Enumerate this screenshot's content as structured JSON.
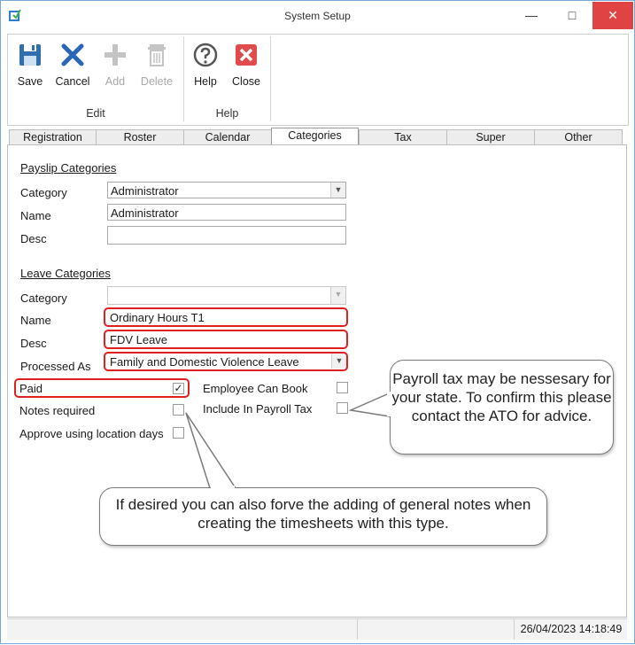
{
  "window": {
    "title": "System Setup",
    "minimize": "—",
    "maximize": "□",
    "close": "✕"
  },
  "ribbon": {
    "buttons": [
      {
        "label": "Save",
        "icon": "save-icon"
      },
      {
        "label": "Cancel",
        "icon": "x-icon"
      },
      {
        "label": "Add",
        "icon": "plus-icon",
        "disabled": true
      },
      {
        "label": "Delete",
        "icon": "trash-icon",
        "disabled": true
      },
      {
        "label": "Help",
        "icon": "question-icon"
      },
      {
        "label": "Close",
        "icon": "close-box-icon"
      }
    ],
    "groups": {
      "edit": "Edit",
      "help": "Help"
    }
  },
  "tabs": [
    "Registration",
    "Roster",
    "Calendar",
    "Categories",
    "Tax",
    "Super",
    "Other"
  ],
  "active_tab": "Categories",
  "payslip": {
    "heading": "Payslip Categories",
    "category_label": "Category",
    "category_value": "Administrator",
    "name_label": "Name",
    "name_value": "Administrator",
    "desc_label": "Desc",
    "desc_value": ""
  },
  "leave": {
    "heading": "Leave Categories",
    "category_label": "Category",
    "category_value": "",
    "name_label": "Name",
    "name_value": "Ordinary Hours T1",
    "desc_label": "Desc",
    "desc_value": "FDV Leave",
    "processed_label": "Processed As",
    "processed_value": "Family and Domestic Violence Leave"
  },
  "checks": {
    "paid": {
      "label": "Paid",
      "checked": true
    },
    "notes": {
      "label": "Notes required",
      "checked": false
    },
    "approve": {
      "label": "Approve using location days",
      "checked": false
    },
    "employee_book": {
      "label": "Employee Can Book",
      "checked": false
    },
    "payroll_tax": {
      "label": "Include In Payroll Tax",
      "checked": false
    }
  },
  "callouts": {
    "payroll": "Payroll tax may be nessesary for your state. To confirm this please contact the ATO for advice.",
    "notes": "If desired you can also forve the adding of general notes when creating the timesheets with this type."
  },
  "status": {
    "datetime": "26/04/2023 14:18:49"
  },
  "colors": {
    "highlight": "#e02020",
    "save": "#2f6fb0",
    "cancel": "#2a66b8",
    "close": "#e24b4b"
  }
}
